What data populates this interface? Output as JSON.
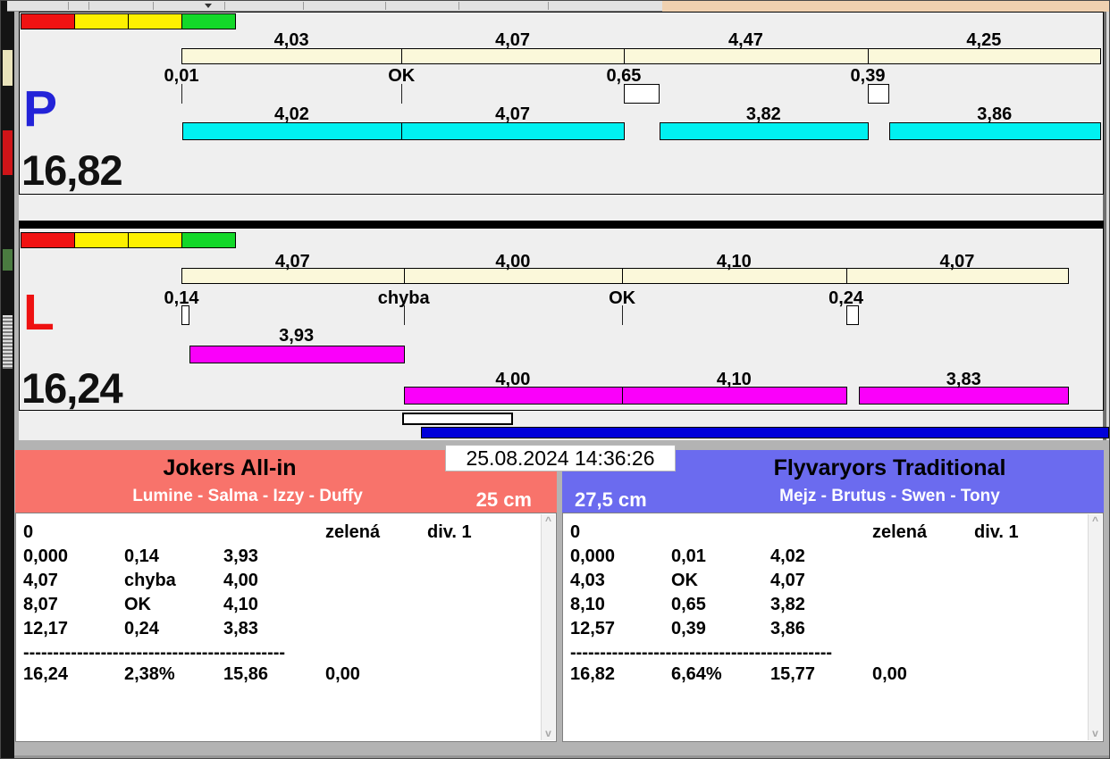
{
  "colors": {
    "light_red": "#f01212",
    "light_yellow": "#fdf000",
    "light_green": "#13d829",
    "split_bar_fill": "#fbf8da",
    "p_net_fill": "#00f1f1",
    "l_net_fill": "#fa00fa",
    "progress_blue": "#0000d9",
    "team_left_header": "#f8736b",
    "team_right_header": "#6b6bef",
    "p_letter": "#2323d8",
    "l_letter": "#ee1111"
  },
  "lanes": [
    {
      "letter": "P",
      "letter_color_key": "p_letter",
      "total_label": "16,82",
      "total_s": 16.82,
      "net_fill_key": "p_net_fill",
      "lights": [
        "light_red",
        "light_yellow",
        "light_yellow",
        "light_green"
      ],
      "legs": [
        {
          "split_label": "4,03",
          "split_s": 4.03,
          "marker_label": "0,01",
          "delay_s": 0.01,
          "net_label": "4,02",
          "net_s": 4.02
        },
        {
          "split_label": "4,07",
          "split_s": 4.07,
          "marker_label": "OK",
          "delay_s": 0,
          "net_label": "4,07",
          "net_s": 4.07
        },
        {
          "split_label": "4,47",
          "split_s": 4.47,
          "marker_label": "0,65",
          "delay_s": 0.65,
          "net_label": "3,82",
          "net_s": 3.82
        },
        {
          "split_label": "4,25",
          "split_s": 4.25,
          "marker_label": "0,39",
          "delay_s": 0.39,
          "net_label": "3,86",
          "net_s": 3.86
        }
      ]
    },
    {
      "letter": "L",
      "letter_color_key": "l_letter",
      "total_label": "16,24",
      "total_s": 16.24,
      "net_fill_key": "l_net_fill",
      "lights": [
        "light_red",
        "light_yellow",
        "light_yellow",
        "light_green"
      ],
      "legs": [
        {
          "split_label": "4,07",
          "split_s": 4.07,
          "marker_label": "0,14",
          "delay_s": 0.14,
          "net_label": "3,93",
          "net_s": 3.93
        },
        {
          "split_label": "4,00",
          "split_s": 4.0,
          "marker_label": "chyba",
          "delay_s": 0,
          "net_label": "4,00",
          "net_s": 4.0
        },
        {
          "split_label": "4,10",
          "split_s": 4.1,
          "marker_label": "OK",
          "delay_s": 0,
          "net_label": "4,10",
          "net_s": 4.1
        },
        {
          "split_label": "4,07",
          "split_s": 4.07,
          "marker_label": "0,24",
          "delay_s": 0.24,
          "net_label": "3,83",
          "net_s": 3.83
        }
      ]
    }
  ],
  "timestamp": "25.08.2024 14:36:26",
  "teams": [
    {
      "name": "Jokers All-in",
      "members": "Lumine - Salma - Izzy - Duffy",
      "jump_height": "25 cm",
      "rows": [
        [
          "0",
          "",
          "",
          "zelená",
          "div. 1"
        ],
        [
          "0,000",
          "0,14",
          "3,93",
          "",
          ""
        ],
        [
          "4,07",
          "chyba",
          "4,00",
          "",
          ""
        ],
        [
          "8,07",
          "OK",
          "4,10",
          "",
          ""
        ],
        [
          "12,17",
          "0,24",
          "3,83",
          "",
          ""
        ]
      ],
      "separator": "--------------------------------------------",
      "summary": [
        "16,24",
        "2,38%",
        "15,86",
        "0,00"
      ]
    },
    {
      "name": "Flyvaryors Traditional",
      "members": "Mejz - Brutus - Swen - Tony",
      "jump_height": "27,5 cm",
      "rows": [
        [
          "0",
          "",
          "",
          "zelená",
          "div. 1"
        ],
        [
          "0,000",
          "0,01",
          "4,02",
          "",
          ""
        ],
        [
          "4,03",
          "OK",
          "4,07",
          "",
          ""
        ],
        [
          "8,10",
          "0,65",
          "3,82",
          "",
          ""
        ],
        [
          "12,57",
          "0,39",
          "3,86",
          "",
          ""
        ]
      ],
      "separator": "--------------------------------------------",
      "summary": [
        "16,82",
        "6,64%",
        "15,77",
        "0,00"
      ]
    }
  ],
  "scrollbar": {
    "up": "^",
    "down": "v"
  }
}
